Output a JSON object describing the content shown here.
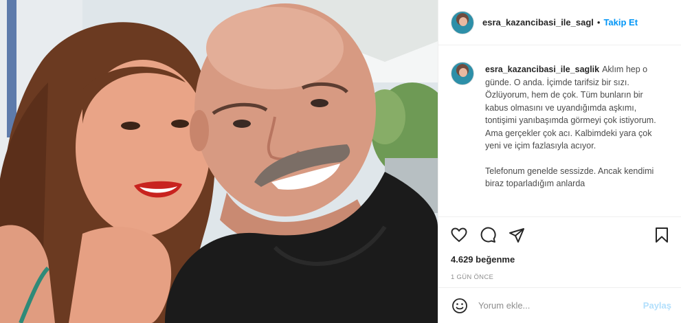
{
  "post": {
    "username": "esra_kazancibasi_ile_sagl",
    "separator": "•",
    "follow_label": "Takip Et"
  },
  "caption": {
    "username": "esra_kazancibasi_ile_saglik",
    "paragraph1": "Aklım hep o günde. O anda. İçimde tarifsiz bir sızı. Özlüyorum, hem de çok. Tüm bunların bir kabus olmasını ve uyandığımda aşkımı, tontişimi yanıbaşımda görmeyi çok istiyorum. Ama gerçekler çok acı. Kalbimdeki yara çok yeni ve içim fazlasıyla acıyor.",
    "paragraph2": "Telefonum genelde sessizde. Ancak kendimi biraz toparladığım anlarda"
  },
  "actions": {
    "like_icon": "heart-icon",
    "comment_icon": "comment-icon",
    "share_icon": "share-icon",
    "save_icon": "bookmark-icon"
  },
  "stats": {
    "likes": "4.629 beğenme",
    "time": "1 GÜN ÖNCE"
  },
  "comment": {
    "placeholder": "Yorum ekle...",
    "post_label": "Paylaş",
    "emoji_icon": "emoji-icon"
  },
  "colors": {
    "accent": "#0095f6",
    "post_disabled": "#b2dffc",
    "muted": "#8e8e8e"
  }
}
